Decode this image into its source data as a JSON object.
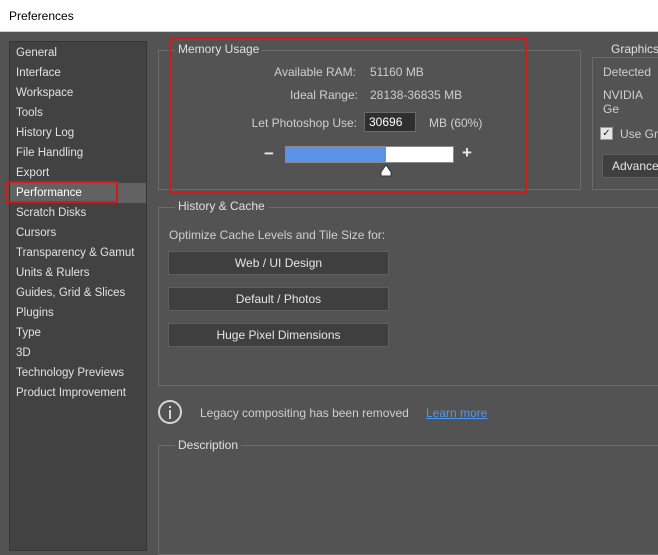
{
  "window": {
    "title": "Preferences"
  },
  "sidebar": {
    "items": [
      {
        "label": "General"
      },
      {
        "label": "Interface"
      },
      {
        "label": "Workspace"
      },
      {
        "label": "Tools"
      },
      {
        "label": "History Log"
      },
      {
        "label": "File Handling"
      },
      {
        "label": "Export"
      },
      {
        "label": "Performance"
      },
      {
        "label": "Scratch Disks"
      },
      {
        "label": "Cursors"
      },
      {
        "label": "Transparency & Gamut"
      },
      {
        "label": "Units & Rulers"
      },
      {
        "label": "Guides, Grid & Slices"
      },
      {
        "label": "Plugins"
      },
      {
        "label": "Type"
      },
      {
        "label": "3D"
      },
      {
        "label": "Technology Previews"
      },
      {
        "label": "Product Improvement"
      }
    ],
    "selected": "Performance"
  },
  "memory": {
    "title": "Memory Usage",
    "available_label": "Available RAM:",
    "available_value": "51160 MB",
    "ideal_label": "Ideal Range:",
    "ideal_value": "28138-36835 MB",
    "let_label": "Let Photoshop Use:",
    "let_value": "30696",
    "let_unit": "MB (60%)",
    "minus": "−",
    "plus": "+",
    "slider_fraction": 0.6
  },
  "graphics": {
    "title": "Graphics",
    "detected": "Detected",
    "gpu": "NVIDIA Ge",
    "use_checkbox": "Use Gr",
    "use_checked": true,
    "advanced_button": "Advance"
  },
  "history_cache": {
    "title": "History & Cache",
    "optimize_label": "Optimize Cache Levels and Tile Size for:",
    "buttons": [
      "Web / UI Design",
      "Default / Photos",
      "Huge Pixel Dimensions"
    ]
  },
  "notice": {
    "text": "Legacy compositing has been removed",
    "link": "Learn more"
  },
  "description": {
    "title": "Description"
  },
  "colors": {
    "highlight_red": "#d11a1a",
    "slider_blue": "#5b93e8",
    "link_blue": "#4a9af5"
  }
}
